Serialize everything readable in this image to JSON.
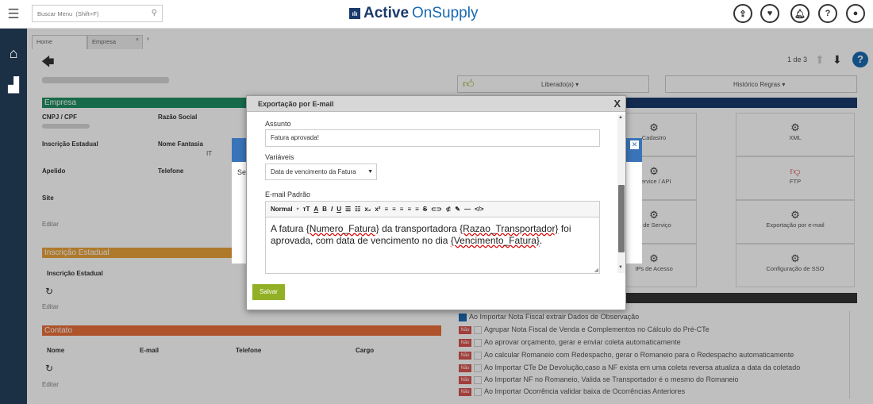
{
  "header": {
    "search_placeholder": "Buscar Menu  (Shift+F)",
    "logo_bold": "Active",
    "logo_light": "OnSupply"
  },
  "tabs": [
    {
      "label": "Home"
    },
    {
      "label": "Empresa"
    }
  ],
  "pager": {
    "text": "1 de 3"
  },
  "actions": {
    "liberado": "Liberado(a) ▾",
    "historico": "Histórico Regras ▾"
  },
  "empresa": {
    "section": "Empresa",
    "cnpj": "CNPJ / CPF",
    "razao": "Razão Social",
    "ie": "Inscrição Estadual",
    "fantasia": "Nome Fantasia",
    "apelido": "Apelido",
    "telefone": "Telefone",
    "site": "Site",
    "editar": "Editar",
    "fantasia_suffix": "IT"
  },
  "ie_section": {
    "title": "Inscrição Estadual",
    "col": "Inscrição Estadual",
    "editar": "Editar"
  },
  "contato": {
    "title": "Contato",
    "nome": "Nome",
    "email": "E-mail",
    "telefone": "Telefone",
    "cargo": "Cargo",
    "editar": "Editar"
  },
  "cards": [
    {
      "label": "Cadastro"
    },
    {
      "label": "XML"
    },
    {
      "label": "Service / API"
    },
    {
      "label": "FTP"
    },
    {
      "label": "el de Serviço"
    },
    {
      "label": "Exportação por e-mail"
    },
    {
      "label": "IPs de Acesso"
    },
    {
      "label": "Configuração de SSO"
    }
  ],
  "rules": [
    {
      "text": "Ao Importar Nota Fiscal extrair Dados de Observação"
    },
    {
      "text": "Agrupar Nota Fiscal de Venda e Complementos no Cálculo do Pré-CTe"
    },
    {
      "text": "Ao aprovar orçamento, gerar e enviar coleta automaticamente"
    },
    {
      "text": "Ao calcular Romaneio com Redespacho, gerar o Romaneio para o Redespacho automaticamente"
    },
    {
      "text": "Ao Importar CTe De Devolução,caso a NF exista em uma coleta reversa atualiza a data da coletado"
    },
    {
      "text": "Ao Importar NF no Romaneio, Valida se Transportador é o mesmo do Romaneio"
    },
    {
      "text": "Ao Importar Ocorrência validar baixa de Ocorrências Anteriores"
    }
  ],
  "rule_badge": "Não",
  "bg_modal_text": "Se",
  "modal": {
    "title": "Exportação por E-mail",
    "close": "X",
    "assunto_label": "Assunto",
    "assunto_value": "Fatura aprovada!",
    "variaveis_label": "Variáveis",
    "variaveis_value": "Data de vencimento da Fatura",
    "email_label": "E-mail Padrão",
    "toolbar_format": "Normal",
    "body_1": "A fatura ",
    "var_1": "{Numero_Fatura}",
    "body_2": " da transportadora ",
    "var_2": "{Razao_Transportador}",
    "body_3": " foi aprovada, com data de vencimento no dia ",
    "var_3": "{Vencimento_Fatura}",
    "body_4": ".",
    "save": "Salvar"
  }
}
